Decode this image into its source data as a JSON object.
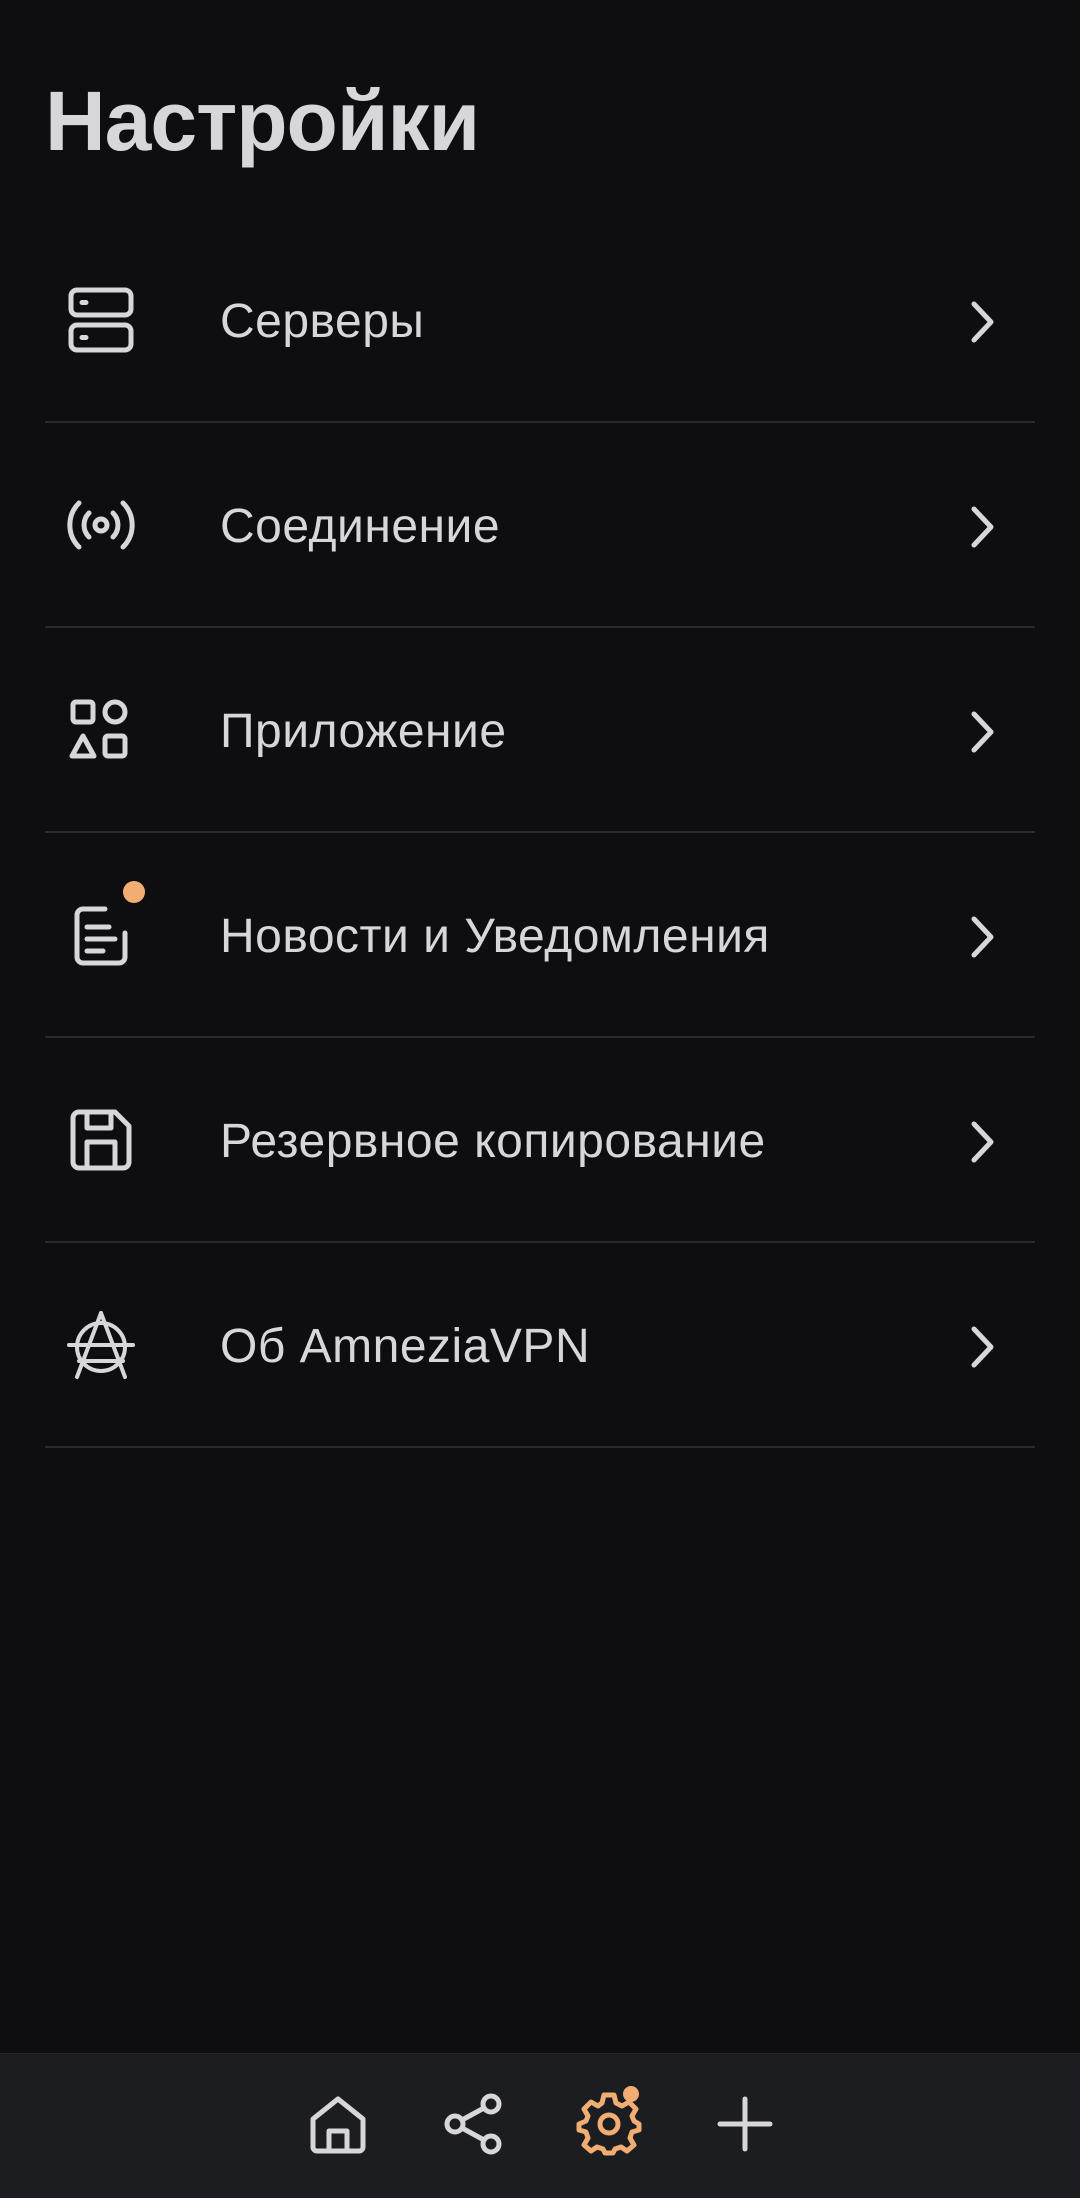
{
  "header": {
    "title": "Настройки"
  },
  "menu": {
    "items": [
      {
        "label": "Серверы",
        "icon": "server-icon"
      },
      {
        "label": "Соединение",
        "icon": "connection-icon"
      },
      {
        "label": "Приложение",
        "icon": "app-shapes-icon"
      },
      {
        "label": "Новости и Уведомления",
        "icon": "news-icon",
        "badge": true
      },
      {
        "label": "Резервное копирование",
        "icon": "save-icon"
      },
      {
        "label": "Об AmneziaVPN",
        "icon": "amnezia-logo-icon"
      }
    ]
  },
  "bottom_nav": {
    "items": [
      {
        "icon": "home-icon",
        "active": false
      },
      {
        "icon": "share-icon",
        "active": false
      },
      {
        "icon": "settings-gear-icon",
        "active": true,
        "badge": true
      },
      {
        "icon": "plus-icon",
        "active": false
      }
    ]
  },
  "colors": {
    "background": "#0e0e10",
    "text": "#d7d7d9",
    "divider": "#2b2b2f",
    "accent": "#f2ad72",
    "nav_background": "#1c1d21"
  }
}
